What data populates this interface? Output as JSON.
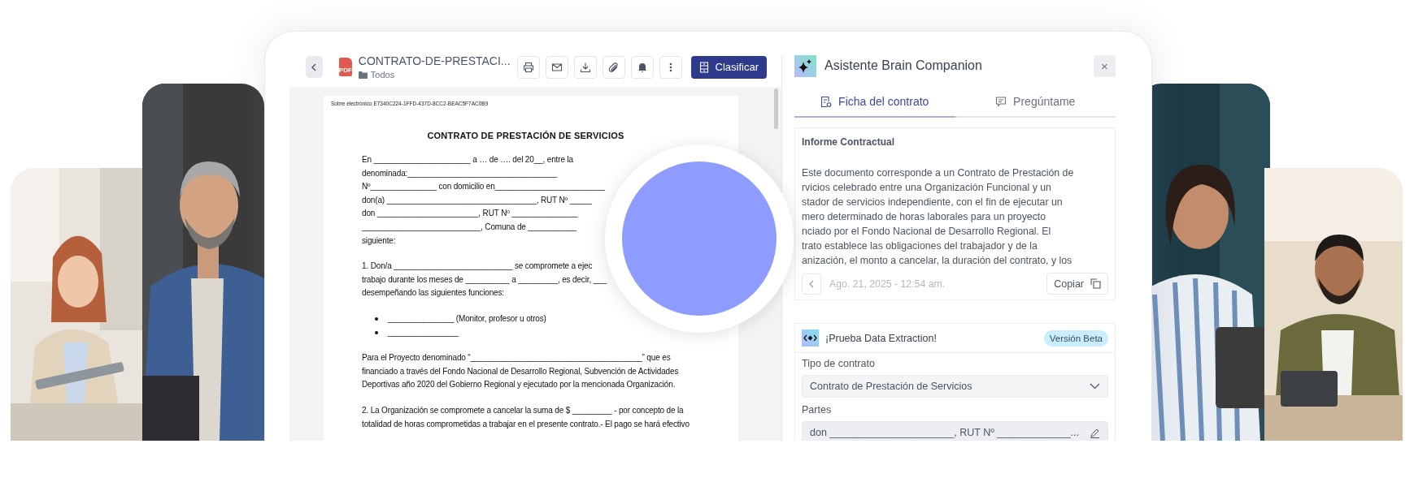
{
  "document": {
    "file_badge": "PDF",
    "title": "CONTRATO-DE-PRESTACI...",
    "folder": "Todos",
    "classify_button": "Clasificar",
    "page": {
      "envelope": "Sobre electrónico E7340C224-1FFD-437D-8CC2-BEAC5F7AC0B9",
      "heading": "CONTRATO DE PRESTACIÓN DE SERVICIOS",
      "blocks": [
        {
          "kind": "paragraph",
          "lines": [
            "En ______________________  a  …  de  ….  del  20__,  entre  la",
            "denominada:__________________________________",
            "Nº_______________ con domicilio en_________________________",
            "don(a) __________________________________, RUT Nº _____",
            "don  _______________________,  RUT  Nº  _______________",
            "___________________________,  Comuna  de  ___________",
            "siguiente:"
          ]
        },
        {
          "kind": "paragraph",
          "lines": [
            "1.  Don/a  ___________________________  se  compromete  a  ejec",
            "trabajo durante los meses de __________ a _________, es decir, ___",
            "desempeñando las siguientes funciones:"
          ]
        },
        {
          "kind": "bullets",
          "lines": [
            "_______________ (Monitor, profesor u otros)",
            "________________"
          ]
        },
        {
          "kind": "paragraph",
          "lines": [
            "Para el Proyecto denominado “_______________________________________” que es",
            "financiado a través del Fondo Nacional de Desarrollo Regional, Subvención de Actividades",
            "Deportivas año 2020 del Gobierno Regional y ejecutado por la mencionada Organización."
          ]
        },
        {
          "kind": "paragraph",
          "lines": [
            "2. La Organización se compromete a cancelar la suma de $ _________ - por concepto de la",
            "totalidad de horas comprometidas a trabajar en el presente contrato.-  El pago se hará efectivo"
          ]
        }
      ]
    }
  },
  "assistant": {
    "title": "Asistente Brain Companion",
    "close": "×",
    "tabs": [
      {
        "label": "Ficha del contrato",
        "selected": true
      },
      {
        "label": "Pregúntame",
        "selected": false
      }
    ],
    "report": {
      "title": "Informe Contractual",
      "lines": [
        "Este documento corresponde a un Contrato de Prestación de",
        "rvicios celebrado entre una Organización Funcional y un",
        "stador de servicios independiente, con el fin de ejecutar un",
        "mero determinado de horas laborales para un proyecto",
        "nciado por el Fondo Nacional de Desarrollo Regional. El",
        "trato establece las obligaciones del trabajador y de la",
        "anización, el monto a cancelar, la duración del contrato, y los"
      ],
      "timestamp": "Ago. 21, 2025 - 12:54 am.",
      "copy_button": "Copiar"
    },
    "extraction": {
      "title": "¡Prueba Data Extraction!",
      "badge": "Versión Beta",
      "fields": [
        {
          "kind": "select",
          "label": "Tipo de contrato",
          "value": "Contrato de Prestación de Servicios"
        },
        {
          "kind": "editable",
          "label": "Partes",
          "value": "don ______________________, RUT Nº _____________..."
        }
      ]
    }
  }
}
